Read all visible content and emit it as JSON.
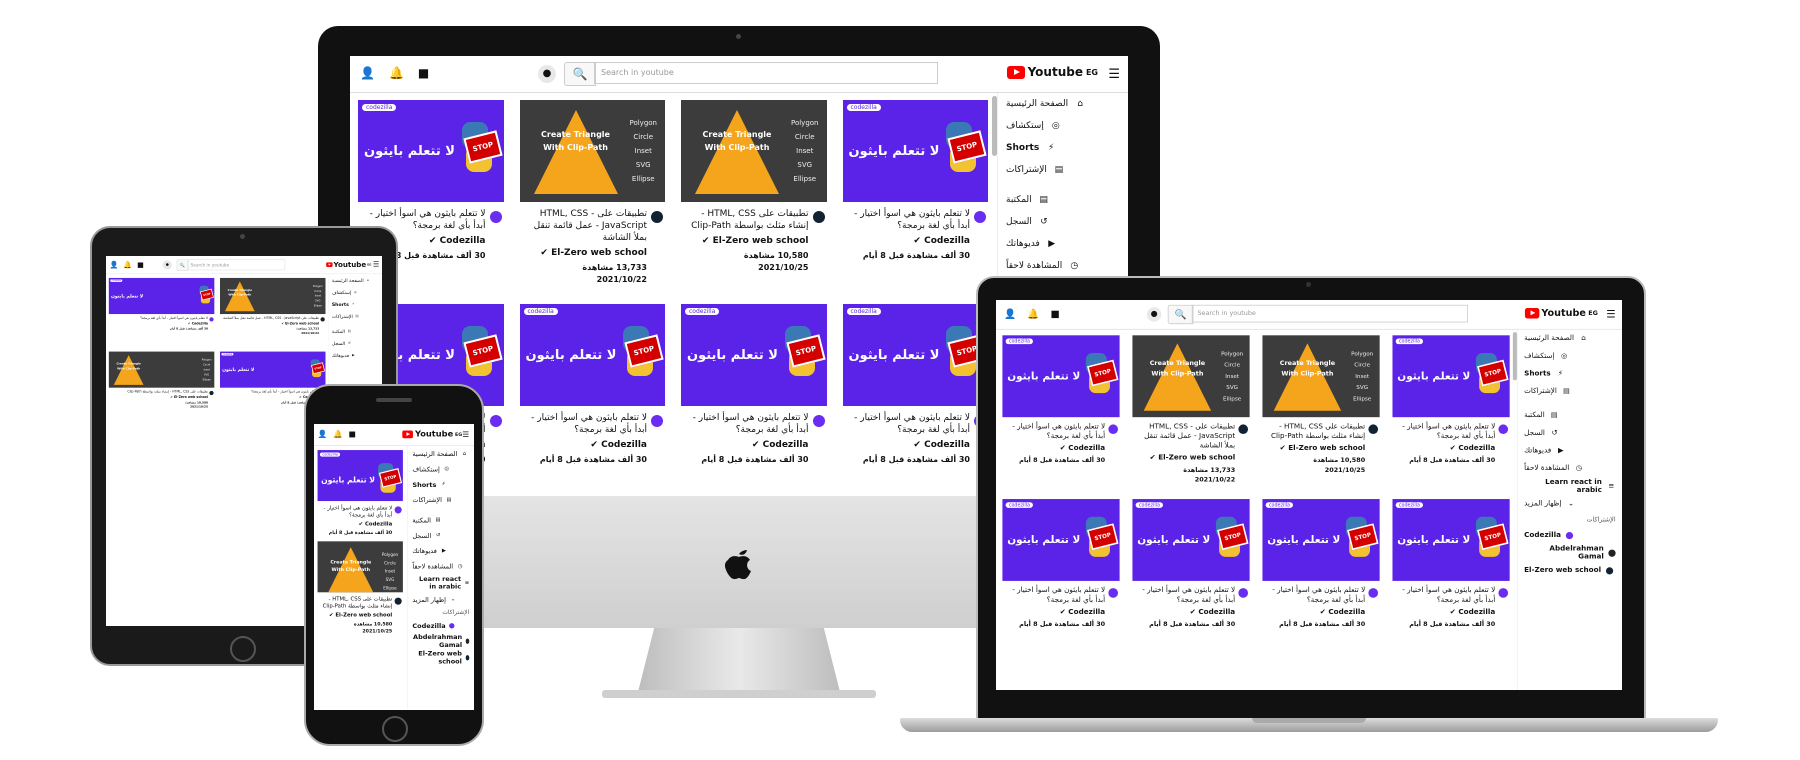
{
  "app": {
    "logo_text": "Youtube",
    "logo_sup": "EG",
    "search_placeholder": "Search in youtube"
  },
  "topbar_icons": [
    "user-icon",
    "bell-icon",
    "video-camera-icon",
    "mic-icon",
    "search-icon",
    "menu-icon"
  ],
  "sidebar": {
    "items": [
      {
        "label": "الصفحة الرئيسية",
        "icon": "⌂"
      },
      {
        "label": "إستكشاف",
        "icon": "◎"
      },
      {
        "label": "Shorts",
        "icon": "⚡"
      },
      {
        "label": "الإشتراكات",
        "icon": "▤"
      },
      {
        "label": "المكتبة",
        "icon": "▤"
      },
      {
        "label": "السجل",
        "icon": "↺"
      },
      {
        "label": "فديوهاتك",
        "icon": "▶"
      },
      {
        "label": "المشاهدة لاحقاً",
        "icon": "◷"
      },
      {
        "label": "Learn react in arabic",
        "icon": "≡"
      },
      {
        "label": "إظهار المزيد",
        "icon": "⌄"
      }
    ],
    "subs_heading": "الإشتراكات",
    "subscriptions": [
      "Codezilla",
      "Abdelrahman Gamal",
      "El-Zero web school"
    ]
  },
  "thumb_text": {
    "brand": "codezilla",
    "python_title": "لا تتعلم بايثون",
    "stop": "STOP",
    "tri_title": "Create Triangle With Clip-Path",
    "shapes": [
      "Polygon",
      "Circle",
      "Inset",
      "SVG",
      "Ellipse"
    ]
  },
  "videos": [
    {
      "kind": "py",
      "title": "لا تتعلم بايثون هي اسوأ اختيار - أبدأ بأي لغة برمجة؟",
      "channel": "Codezilla ✔",
      "views": "30 ألف مشاهدة قبل 8 أيام",
      "date": ""
    },
    {
      "kind": "tri",
      "title": "تطبيقات على HTML, CSS - JavaScript - عمل قائمة تنقل بملأ الشاشة",
      "channel": "El-Zero web school ✔",
      "views": "13,733 مشاهدة",
      "date": "2021/10/22"
    },
    {
      "kind": "tri",
      "title": "تطبيقات على HTML, CSS - إنشاء مثلث بواسطة Clip-Path",
      "channel": "El-Zero web school ✔",
      "views": "10,580 مشاهدة",
      "date": "2021/10/25"
    },
    {
      "kind": "py",
      "title": "لا تتعلم بايثون هي اسوأ اختيار - أبدأ بأي لغة برمجة؟",
      "channel": "Codezilla ✔",
      "views": "30 ألف مشاهدة قبل 8 أيام",
      "date": ""
    },
    {
      "kind": "py",
      "title": "لا تتعلم بايثون هي اسوأ اختيار - أبدأ بأي لغة برمجة؟",
      "channel": "Codezilla ✔",
      "views": "30 ألف مشاهدة قبل 8 أيام",
      "date": ""
    },
    {
      "kind": "py",
      "title": "لا تتعلم بايثون هي اسوأ اختيار - أبدأ بأي لغة برمجة؟",
      "channel": "Codezilla ✔",
      "views": "30 ألف مشاهدة قبل 8 أيام",
      "date": ""
    },
    {
      "kind": "py",
      "title": "لا تتعلم بايثون هي اسوأ اختيار - أبدأ بأي لغة برمجة؟",
      "channel": "Codezilla ✔",
      "views": "30 ألف مشاهدة قبل 8 أيام",
      "date": ""
    },
    {
      "kind": "py",
      "title": "لا تتعلم بايثون هي اسوأ اختيار - أبدأ بأي لغة برمجة؟",
      "channel": "Codezilla ✔",
      "views": "30 ألف مشاهدة قبل 8 أيام",
      "date": ""
    }
  ],
  "colors": {
    "brand_red": "#ff0000",
    "codezilla_purple": "#5b22e8",
    "triangle_orange": "#f4a51c",
    "thumb_dark": "#3c3c3c"
  }
}
